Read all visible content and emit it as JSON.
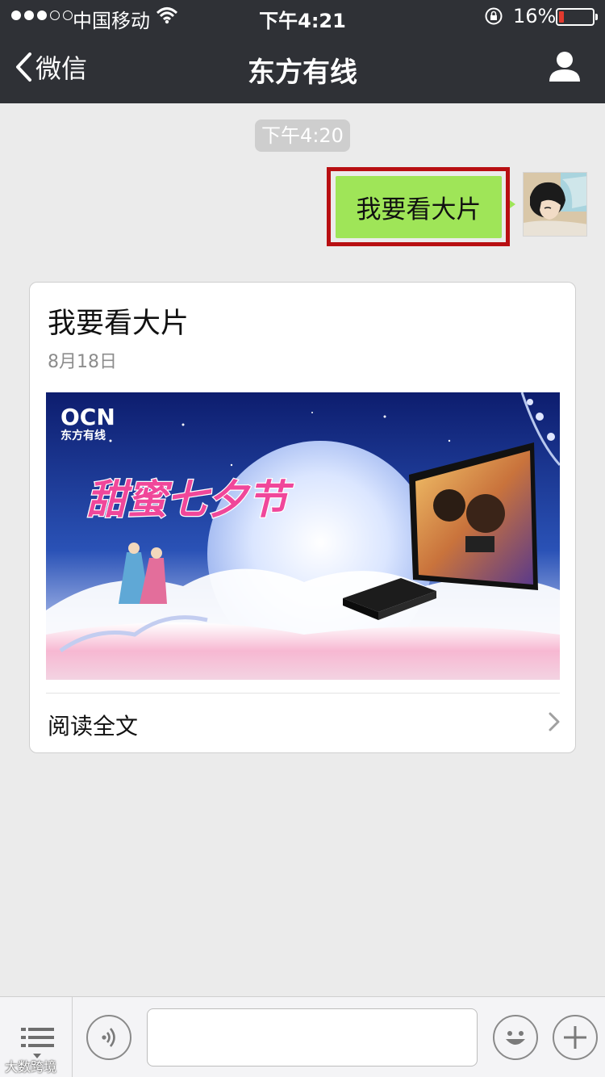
{
  "status_bar": {
    "carrier": "中国移动",
    "time": "下午4:21",
    "battery_percent": "16%",
    "battery_level": 0.16,
    "signal_bars_filled": 3,
    "signal_bars_total": 5
  },
  "nav": {
    "back_label": "微信",
    "title": "东方有线"
  },
  "chat": {
    "timestamp": "下午4:20",
    "outgoing_message": "我要看大片"
  },
  "article": {
    "title": "我要看大片",
    "date": "8月18日",
    "banner": {
      "logo": "OCN",
      "logo_sub": "东方有线",
      "headline": "甜蜜七夕节"
    },
    "read_more": "阅读全文"
  },
  "input_bar": {
    "text_value": "",
    "placeholder": ""
  },
  "watermark": "大数跨境",
  "colors": {
    "nav_bg": "#2f3136",
    "chat_bg": "#ebebeb",
    "bubble_green": "#9fe558",
    "highlight_red": "#b80f12",
    "battery_red": "#e23a2e"
  },
  "icons": {
    "back": "chevron-left-icon",
    "profile": "person-icon",
    "voice": "voice-icon",
    "emoji": "smiley-icon",
    "plus": "plus-icon",
    "menu": "menu-icon",
    "read_more": "chevron-right-icon"
  }
}
